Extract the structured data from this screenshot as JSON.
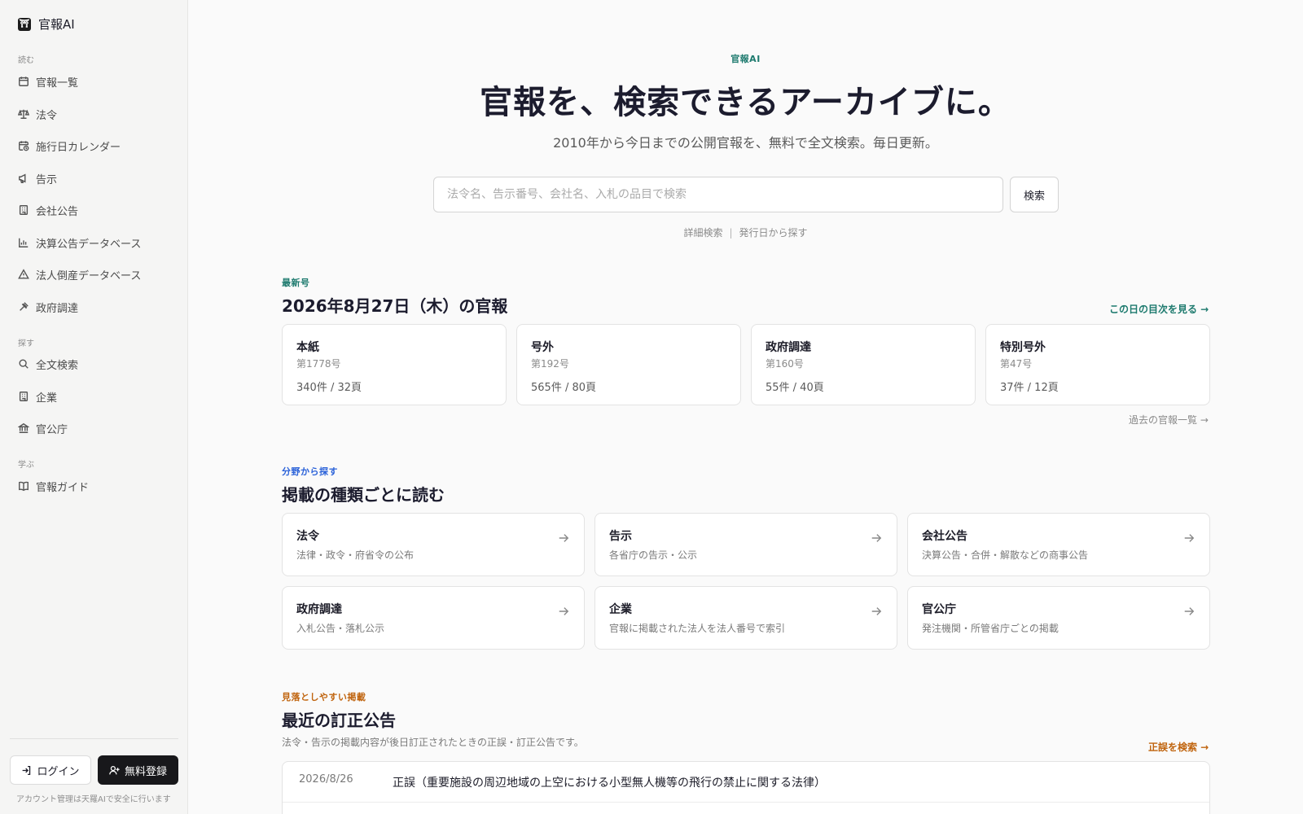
{
  "colors": {
    "accent_teal": "#1d7a6e",
    "accent_blue": "#2b62d9",
    "accent_orange": "#c0640e",
    "dark_button": "#18181b"
  },
  "sidebar": {
    "brand": "官報AI",
    "sections": [
      {
        "label": "読む",
        "items": [
          {
            "label": "官報一覧",
            "icon": "calendar-icon"
          },
          {
            "label": "法令",
            "icon": "scale-icon"
          },
          {
            "label": "施行日カレンダー",
            "icon": "calendar-clock-icon"
          },
          {
            "label": "告示",
            "icon": "megaphone-icon"
          },
          {
            "label": "会社公告",
            "icon": "building-icon"
          },
          {
            "label": "決算公告データベース",
            "icon": "bar-chart-icon"
          },
          {
            "label": "法人倒産データベース",
            "icon": "warning-icon"
          },
          {
            "label": "政府調達",
            "icon": "gavel-icon"
          }
        ]
      },
      {
        "label": "探す",
        "items": [
          {
            "label": "全文検索",
            "icon": "search-icon"
          },
          {
            "label": "企業",
            "icon": "building-icon"
          },
          {
            "label": "官公庁",
            "icon": "landmark-icon"
          }
        ]
      },
      {
        "label": "学ぶ",
        "items": [
          {
            "label": "官報ガイド",
            "icon": "book-icon"
          }
        ]
      }
    ],
    "login_label": "ログイン",
    "signup_label": "無料登録",
    "note": "アカウント管理は天羅AIで安全に行います"
  },
  "hero": {
    "eyebrow": "官報AI",
    "title": "官報を、検索できるアーカイブに。",
    "subtitle": "2010年から今日までの公開官報を、無料で全文検索。毎日更新。",
    "search_placeholder": "法令名、告示番号、会社名、入札の品目で検索",
    "search_button": "検索",
    "link_advanced": "詳細検索",
    "link_separator": "|",
    "link_by_date": "発行日から探す"
  },
  "latest": {
    "eyebrow": "最新号",
    "title": "2026年8月27日（木）の官報",
    "toc_link": "この日の目次を見る →",
    "issues": [
      {
        "name": "本紙",
        "number": "第1778号",
        "count": "340件 / 32頁"
      },
      {
        "name": "号外",
        "number": "第192号",
        "count": "565件 / 80頁"
      },
      {
        "name": "政府調達",
        "number": "第160号",
        "count": "55件 / 40頁"
      },
      {
        "name": "特別号外",
        "number": "第47号",
        "count": "37件 / 12頁"
      }
    ],
    "past_link": "過去の官報一覧 →"
  },
  "categories": {
    "eyebrow": "分野から探す",
    "title": "掲載の種類ごとに読む",
    "items": [
      {
        "name": "法令",
        "desc": "法律・政令・府省令の公布"
      },
      {
        "name": "告示",
        "desc": "各省庁の告示・公示"
      },
      {
        "name": "会社公告",
        "desc": "決算公告・合併・解散などの商事公告"
      },
      {
        "name": "政府調達",
        "desc": "入札公告・落札公示"
      },
      {
        "name": "企業",
        "desc": "官報に掲載された法人を法人番号で索引"
      },
      {
        "name": "官公庁",
        "desc": "発注機関・所管省庁ごとの掲載"
      }
    ]
  },
  "corrections": {
    "eyebrow": "見落としやすい掲載",
    "title": "最近の訂正公告",
    "description": "法令・告示の掲載内容が後日訂正されたときの正誤・訂正公告です。",
    "search_link": "正誤を検索 →",
    "rows": [
      {
        "date": "2026/8/26",
        "title": "正誤（重要施設の周辺地域の上空における小型無人機等の飛行の禁止に関する法律）"
      }
    ]
  }
}
